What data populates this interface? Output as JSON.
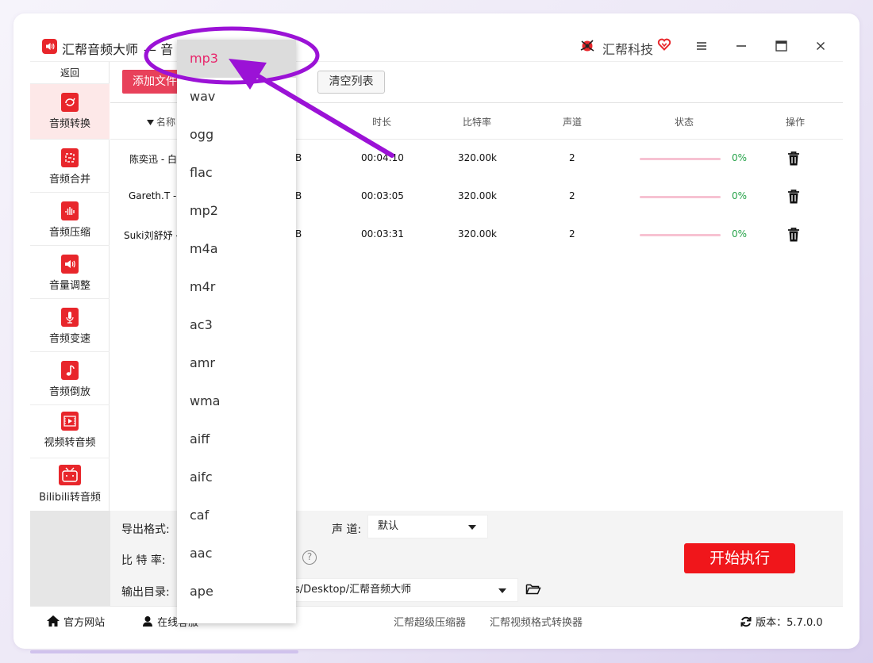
{
  "app": {
    "title": "汇帮音频大师",
    "title_sep": "—",
    "title_tail": "音",
    "brand": "汇帮科技"
  },
  "sidebar": {
    "back": "返回",
    "items": [
      {
        "label": "音频转换",
        "icon": "audio-convert-icon",
        "active": true
      },
      {
        "label": "音频合并",
        "icon": "audio-merge-icon"
      },
      {
        "label": "音频压缩",
        "icon": "audio-compress-icon"
      },
      {
        "label": "音量调整",
        "icon": "volume-adjust-icon"
      },
      {
        "label": "音频变速",
        "icon": "audio-speed-icon"
      },
      {
        "label": "音频倒放",
        "icon": "audio-reverse-icon"
      },
      {
        "label": "视频转音频",
        "icon": "video-to-audio-icon"
      },
      {
        "label": "Bilibili转音频",
        "icon": "bilibili-icon"
      }
    ]
  },
  "toolbar": {
    "add_label": "添加文件",
    "clear_label": "清空列表"
  },
  "table": {
    "headers": {
      "name": "名称",
      "duration": "时长",
      "bitrate": "比特率",
      "channels": "声道",
      "status": "状态",
      "action": "操作"
    },
    "rows": [
      {
        "name": "陈奕迅 - 白",
        "size": "B",
        "duration": "00:04:10",
        "bitrate": "320.00k",
        "channels": "2",
        "progress": "0%"
      },
      {
        "name": "Gareth.T -",
        "size": "B",
        "duration": "00:03:05",
        "bitrate": "320.00k",
        "channels": "2",
        "progress": "0%"
      },
      {
        "name": "Suki刘舒妤 -",
        "size": "B",
        "duration": "00:03:31",
        "bitrate": "320.00k",
        "channels": "2",
        "progress": "0%"
      }
    ]
  },
  "settings": {
    "format_label": "导出格式:",
    "channel_label": "声 道:",
    "channel_value": "默认",
    "bitrate_label": "比 特 率:",
    "output_label": "输出目录:",
    "output_value": "s/Desktop/汇帮音频大师",
    "start_label": "开始执行"
  },
  "footer": {
    "website": "官方网站",
    "support": "在线客服",
    "link1": "汇帮超级压缩器",
    "link2": "汇帮视频格式转换器",
    "version": "版本：5.7.0.0"
  },
  "dropdown": {
    "selected": "mp3",
    "options": [
      "mp3",
      "wav",
      "ogg",
      "flac",
      "mp2",
      "m4a",
      "m4r",
      "ac3",
      "amr",
      "wma",
      "aiff",
      "aifc",
      "caf",
      "aac",
      "ape"
    ]
  },
  "colors": {
    "accent_red": "#e8262b",
    "start_button": "#f0161b",
    "progress_text": "#27a34a",
    "annotation_purple": "#9b12d6"
  }
}
